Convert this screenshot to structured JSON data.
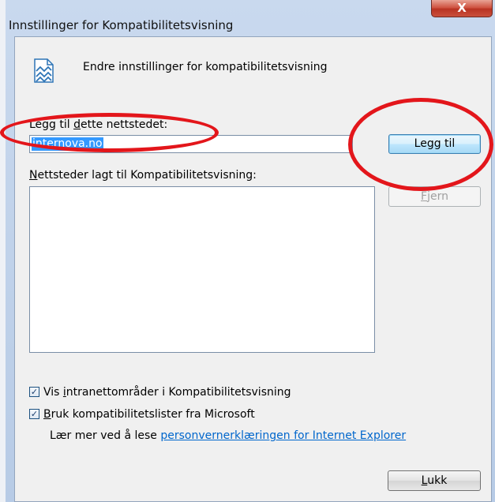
{
  "dialog": {
    "title": "Innstillinger for Kompatibilitetsvisning",
    "close_label": "X",
    "header_text": "Endre innstillinger for kompatibilitetsvisning",
    "add_site": {
      "label_before": "Legg til ",
      "label_accel": "d",
      "label_after": "ette nettstedet:",
      "value": "internova.no"
    },
    "add_button_label": "Legg til",
    "list": {
      "label_accel": "N",
      "label_rest": "ettsteder lagt til Kompatibilitetsvisning:",
      "items": []
    },
    "remove_button": {
      "accel": "F",
      "rest": "jern"
    },
    "options": [
      {
        "checked": true,
        "before": "Vis ",
        "accel": "i",
        "after": "ntranettområder i Kompatibilitetsvisning"
      },
      {
        "checked": true,
        "before": "",
        "accel": "B",
        "after": "ruk kompatibilitetslister fra Microsoft"
      }
    ],
    "learn_more": {
      "text": "Lær mer ved å lese ",
      "link": "personvernerklæringen for Internet Explorer"
    },
    "close_button": {
      "accel": "L",
      "rest": "ukk"
    }
  },
  "colors": {
    "annotation": "#e3161b",
    "selection": "#3399ff",
    "link": "#0066cc"
  }
}
